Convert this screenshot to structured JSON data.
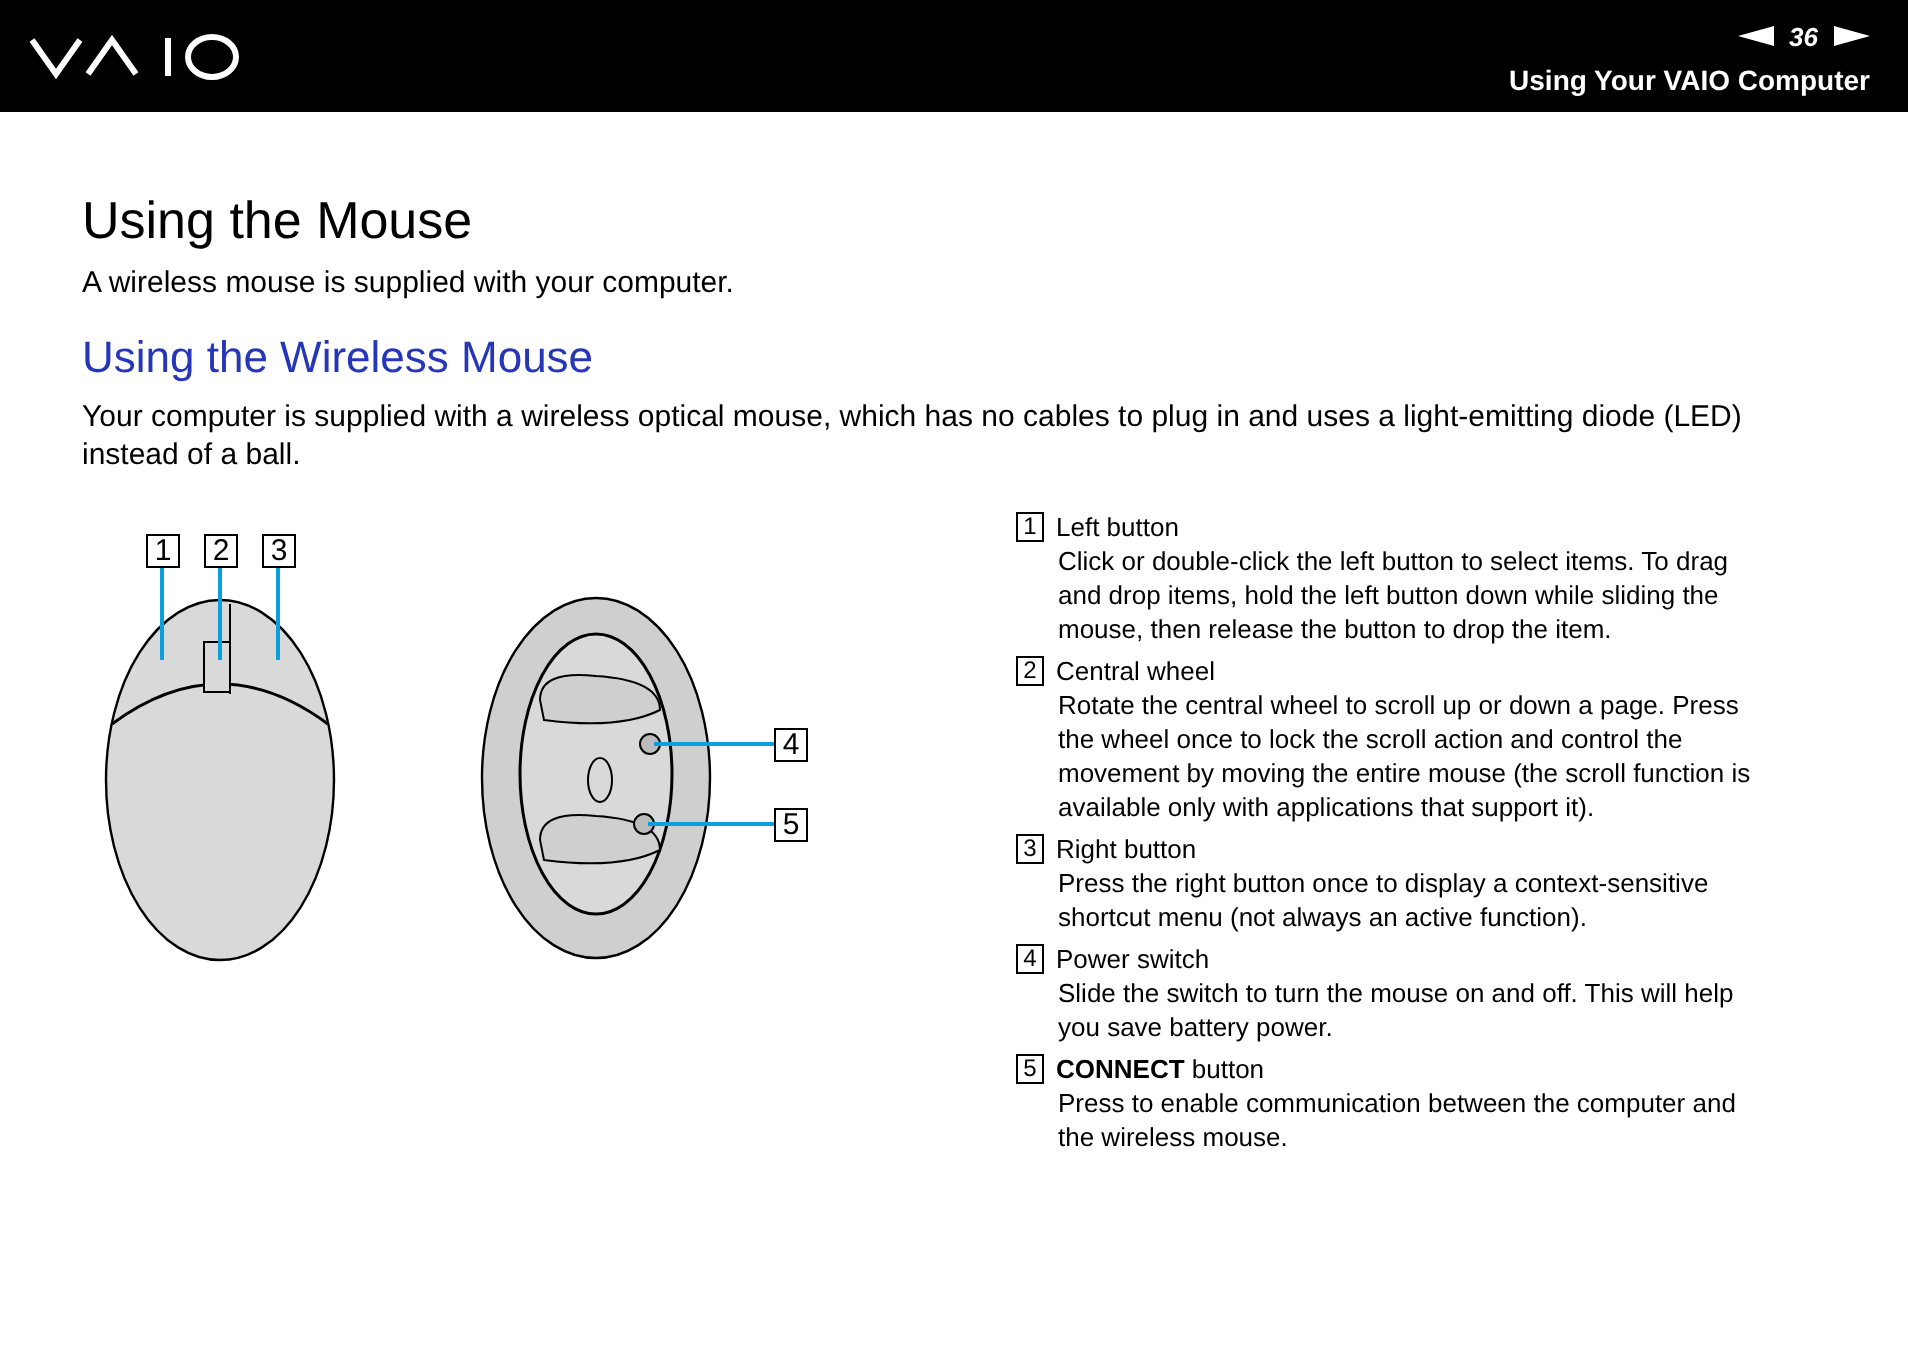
{
  "header": {
    "page_number": "36",
    "section": "Using Your VAIO Computer"
  },
  "title": "Using the Mouse",
  "intro": "A wireless mouse is supplied with your computer.",
  "subtitle": "Using the Wireless Mouse",
  "paragraph": "Your computer is supplied with a wireless optical mouse, which has no cables to plug in and uses a light-emitting diode (LED) instead of a ball.",
  "figure": {
    "top_view_callouts": [
      "1",
      "2",
      "3"
    ],
    "bottom_view_callouts": [
      "4",
      "5"
    ]
  },
  "parts": [
    {
      "number": "1",
      "name": "Left button",
      "description": "Click or double-click the left button to select items. To drag and drop items, hold the left button down while sliding the mouse, then release the button to drop the item."
    },
    {
      "number": "2",
      "name": "Central wheel",
      "description": "Rotate the central wheel to scroll up or down a page. Press the wheel once to lock the scroll action and control the movement by moving the entire mouse (the scroll function is available only with applications that support it)."
    },
    {
      "number": "3",
      "name": "Right button",
      "description": "Press the right button once to display a context-sensitive shortcut menu (not always an active function)."
    },
    {
      "number": "4",
      "name": "Power switch",
      "description": "Slide the switch to turn the mouse on and off. This will help you save battery power."
    },
    {
      "number": "5",
      "name": "**CONNECT** button",
      "description": "Press to enable communication between the computer and the wireless mouse."
    }
  ]
}
